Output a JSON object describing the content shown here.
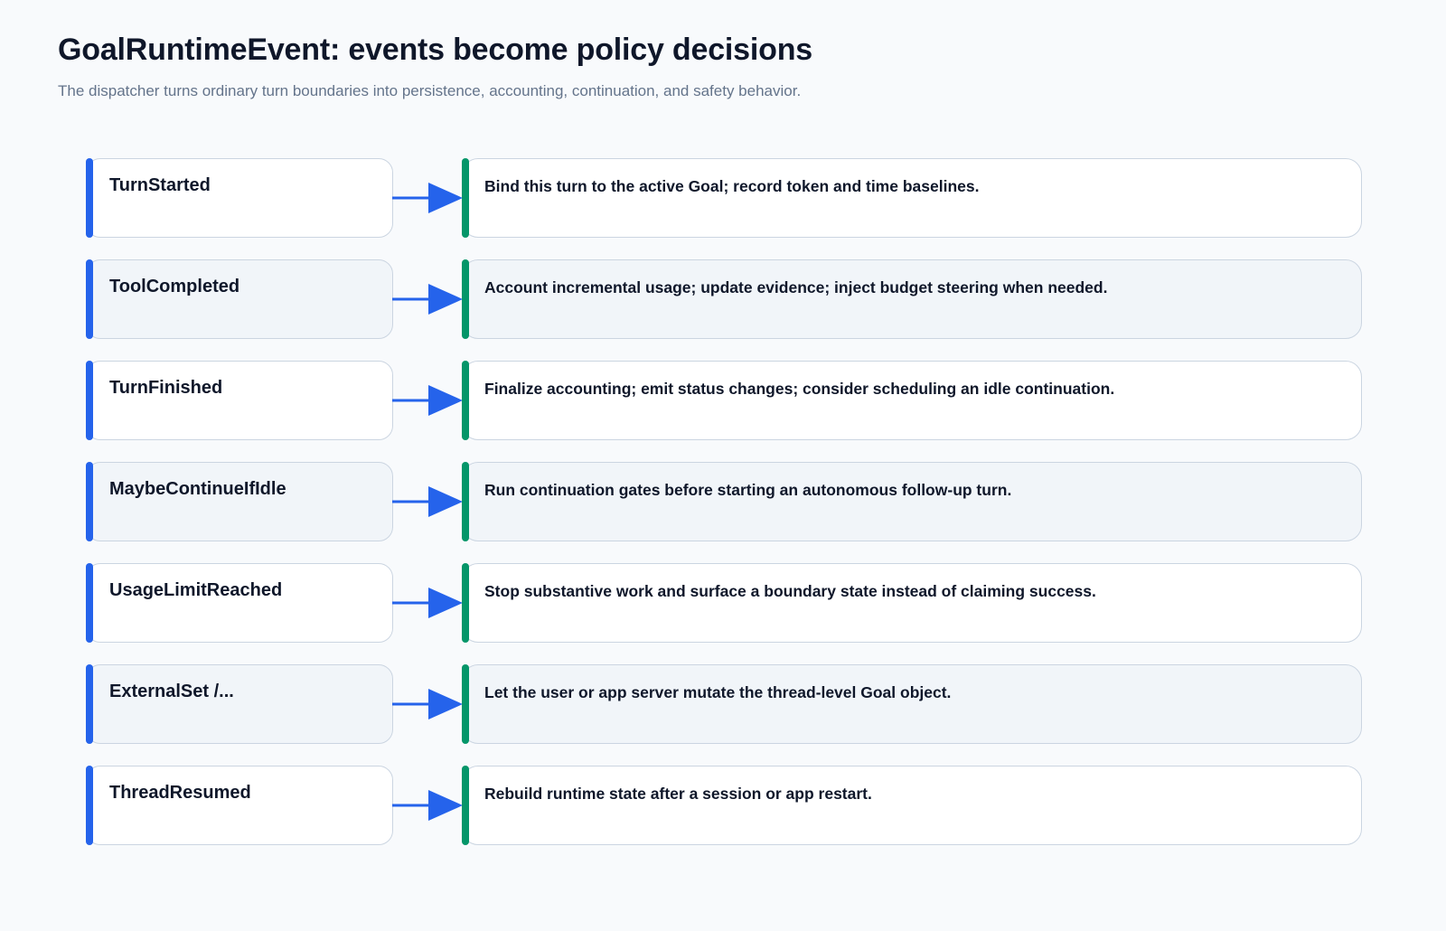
{
  "title": "GoalRuntimeEvent: events become policy decisions",
  "subtitle": "The dispatcher turns ordinary turn boundaries into persistence, accounting, continuation, and safety behavior.",
  "colors": {
    "background": "#f8fafc",
    "event_accent": "#2563eb",
    "decision_accent": "#059669",
    "arrow": "#2563eb",
    "box_border": "#cbd5e1",
    "box_fill": "#ffffff",
    "box_fill_alt": "#f1f5f9",
    "title_text": "#0f172a",
    "subtitle_text": "#64748b"
  },
  "rows": [
    {
      "event": "TurnStarted",
      "decision": "Bind this turn to the active Goal; record token and time baselines."
    },
    {
      "event": "ToolCompleted",
      "decision": "Account incremental usage; update evidence; inject budget steering when needed."
    },
    {
      "event": "TurnFinished",
      "decision": "Finalize accounting; emit status changes; consider scheduling an idle continuation."
    },
    {
      "event": "MaybeContinueIfIdle",
      "decision": "Run continuation gates before starting an autonomous follow-up turn."
    },
    {
      "event": "UsageLimitReached",
      "decision": "Stop substantive work and surface a boundary state instead of claiming success."
    },
    {
      "event": "ExternalSet /...",
      "decision": "Let the user or app server mutate the thread-level Goal object."
    },
    {
      "event": "ThreadResumed",
      "decision": "Rebuild runtime state after a session or app restart."
    }
  ]
}
